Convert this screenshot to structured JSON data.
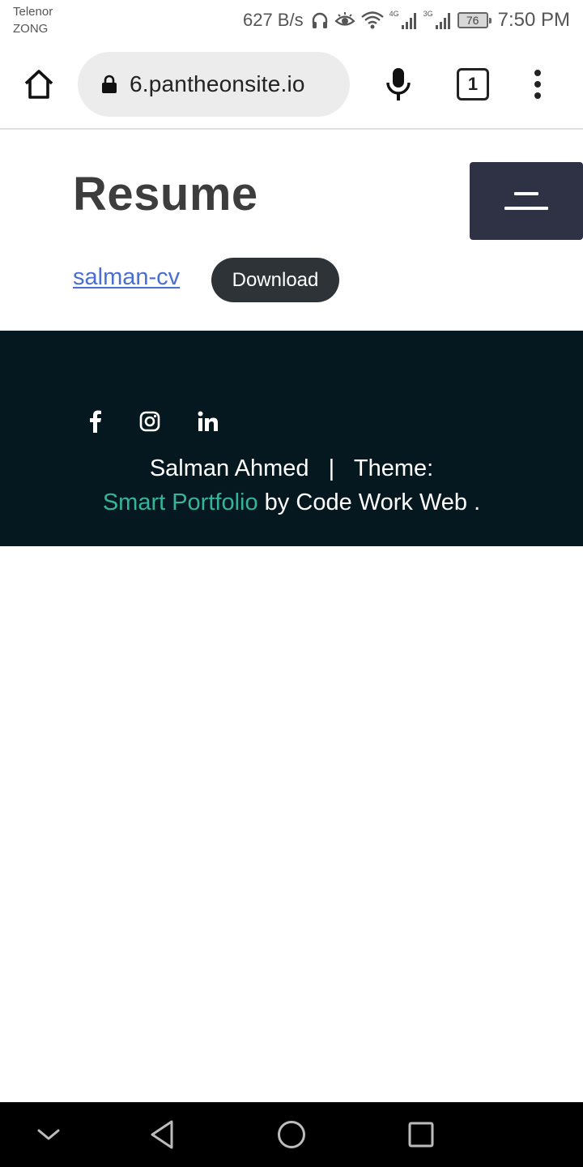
{
  "status_bar": {
    "carrier_1": "Telenor",
    "carrier_2": "ZONG",
    "net_speed": "627 B/s",
    "signal_1_label": "4G",
    "signal_2_label": "3G",
    "battery": "76",
    "time": "7:50 PM"
  },
  "browser": {
    "url": "6.pantheonsite.io",
    "tab_count": "1",
    "icons": [
      "home-icon",
      "lock-icon",
      "mic-icon",
      "tab-switcher-icon",
      "more-vert-icon"
    ]
  },
  "page": {
    "title": "Resume",
    "file_link": "salman-cv",
    "download_label": "Download"
  },
  "footer": {
    "name": "Salman Ahmed",
    "separator": "|",
    "theme_label": "Theme:",
    "theme_name": "Smart Portfolio",
    "by_label": "by",
    "author": "Code Work Web",
    "period": ".",
    "social_icons": [
      "facebook-icon",
      "instagram-icon",
      "linkedin-icon"
    ]
  },
  "colors": {
    "footer_bg": "#051820",
    "theme_link": "#34b59b",
    "download_bg": "#2d3337",
    "menu_bg": "#2f3144",
    "link": "#4a6fd1"
  }
}
